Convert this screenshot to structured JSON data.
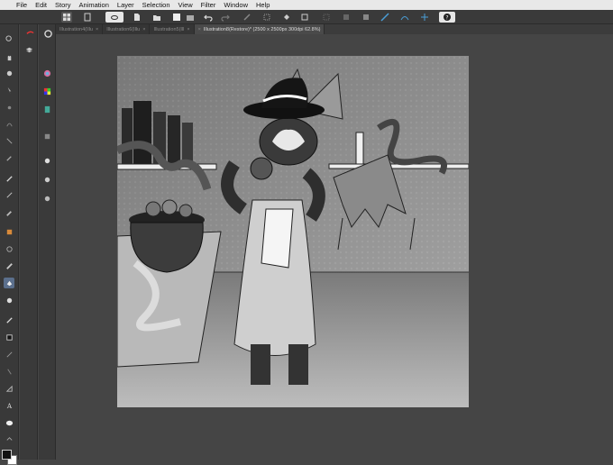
{
  "menubar": {
    "items": [
      "File",
      "Edit",
      "Story",
      "Animation",
      "Layer",
      "Selection",
      "View",
      "Filter",
      "Window",
      "Help"
    ]
  },
  "tabs": [
    {
      "label": "Illustration4(Illu"
    },
    {
      "label": "Illustration6(Illu"
    },
    {
      "label": "Illustration5(Ill"
    },
    {
      "label": "Illustration8(Restore)* (2500 x 2500px 300dpi 62.8%)",
      "active": true
    }
  ],
  "colors": {
    "toolbar_bg": "#3a3a3a",
    "canvas_bg": "#454545",
    "selected_tool": "#5b6f8c",
    "accent_blue": "#4a9fd8"
  },
  "icons": {
    "apple": "apple-logo",
    "help": "question-icon"
  }
}
